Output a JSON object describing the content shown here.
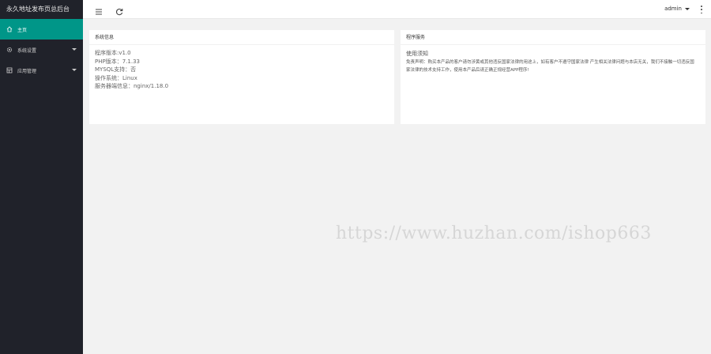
{
  "sidebar": {
    "logo": "永久地址发布页总后台",
    "items": [
      {
        "label": "主页",
        "icon": "home-icon",
        "active": true
      },
      {
        "label": "系统设置",
        "icon": "gear-icon"
      },
      {
        "label": "应用管理",
        "icon": "app-icon"
      }
    ]
  },
  "header": {
    "user": "admin",
    "icons": [
      "menu-icon",
      "refresh-icon",
      "chevron-down-icon",
      "more-vertical-icon"
    ]
  },
  "system_info": {
    "title": "系统信息",
    "lines": [
      "程序版本:v1.0",
      "PHP版本：7.1.33",
      "MYSQL支持：否",
      "操作系统：Linux",
      "服务器端信息：nginx/1.18.0"
    ]
  },
  "program_service": {
    "title": "程序服务",
    "subtitle": "使用须知",
    "text": "免责声明：购买本产品的客户请勿涉黄或其他违反国家法律的用途上，如有客户不遵守国家法律 产生相关法律问题与本店无关，我们不接触一切违反国家法律的技术支持工作，使用本产品后请正确正规经营APP程序!"
  },
  "watermark": "https://www.huzhan.com/ishop663",
  "colors": {
    "sidebar": "#20222a",
    "accent": "#009688",
    "background": "#f2f2f2"
  }
}
